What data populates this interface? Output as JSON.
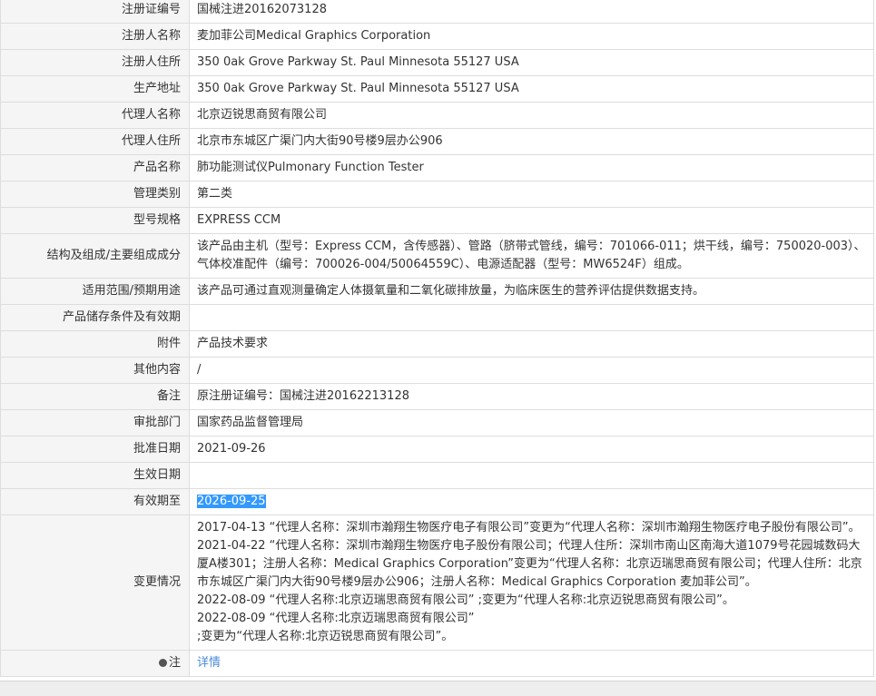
{
  "rows": [
    {
      "label": "注册证编号",
      "value": "国械注进20162073128"
    },
    {
      "label": "注册人名称",
      "value": "麦加菲公司Medical Graphics Corporation"
    },
    {
      "label": "注册人住所",
      "value": "350 0ak Grove Parkway St. Paul Minnesota 55127 USA"
    },
    {
      "label": "生产地址",
      "value": "350 0ak Grove Parkway St. Paul Minnesota 55127 USA"
    },
    {
      "label": "代理人名称",
      "value": "北京迈锐思商贸有限公司"
    },
    {
      "label": "代理人住所",
      "value": "北京市东城区广渠门内大街90号楼9层办公906"
    },
    {
      "label": "产品名称",
      "value": "肺功能测试仪Pulmonary Function Tester"
    },
    {
      "label": "管理类别",
      "value": "第二类"
    },
    {
      "label": "型号规格",
      "value": "EXPRESS CCM"
    },
    {
      "label": "结构及组成/主要组成成分",
      "value": "该产品由主机（型号：Express CCM，含传感器）、管路（脐带式管线，编号：701066-011；烘干线，编号：750020-003）、气体校准配件（编号：700026-004/50064559C）、电源适配器（型号：MW6524F）组成。"
    },
    {
      "label": "适用范围/预期用途",
      "value": "该产品可通过直观测量确定人体摄氧量和二氧化碳排放量，为临床医生的营养评估提供数据支持。"
    },
    {
      "label": "产品储存条件及有效期",
      "value": ""
    },
    {
      "label": "附件",
      "value": "产品技术要求"
    },
    {
      "label": "其他内容",
      "value": "/"
    },
    {
      "label": "备注",
      "value": "原注册证编号：国械注进20162213128"
    },
    {
      "label": "审批部门",
      "value": "国家药品监督管理局"
    },
    {
      "label": "批准日期",
      "value": "2021-09-26"
    },
    {
      "label": "生效日期",
      "value": ""
    },
    {
      "label": "有效期至",
      "value": "2026-09-25"
    }
  ],
  "changes": {
    "label": "变更情况",
    "lines": [
      "2017-04-13 “代理人名称：深圳市瀚翔生物医疗电子有限公司”变更为“代理人名称：深圳市瀚翔生物医疗电子股份有限公司”。",
      "2021-04-22 “代理人名称：深圳市瀚翔生物医疗电子股份有限公司；代理人住所：深圳市南山区南海大道1079号花园城数码大厦A楼301；注册人名称：Medical Graphics Corporation”变更为“代理人名称：北京迈瑞思商贸有限公司；代理人住所：北京市东城区广渠门内大街90号楼9层办公906；注册人名称：Medical Graphics Corporation 麦加菲公司”。",
      "2022-08-09 “代理人名称:北京迈瑞思商贸有限公司” ;变更为“代理人名称:北京迈锐思商贸有限公司”。",
      "2022-08-09 “代理人名称:北京迈瑞思商贸有限公司”",
      ";变更为“代理人名称:北京迈锐思商贸有限公司”。"
    ]
  },
  "note": {
    "label": "注",
    "icon": "info-dot-icon",
    "link_text": "详情"
  },
  "colors": {
    "label_bg": "#f5f5f5",
    "border": "#dddddd",
    "selection": "#3399ff",
    "link": "#4a8ad8"
  }
}
